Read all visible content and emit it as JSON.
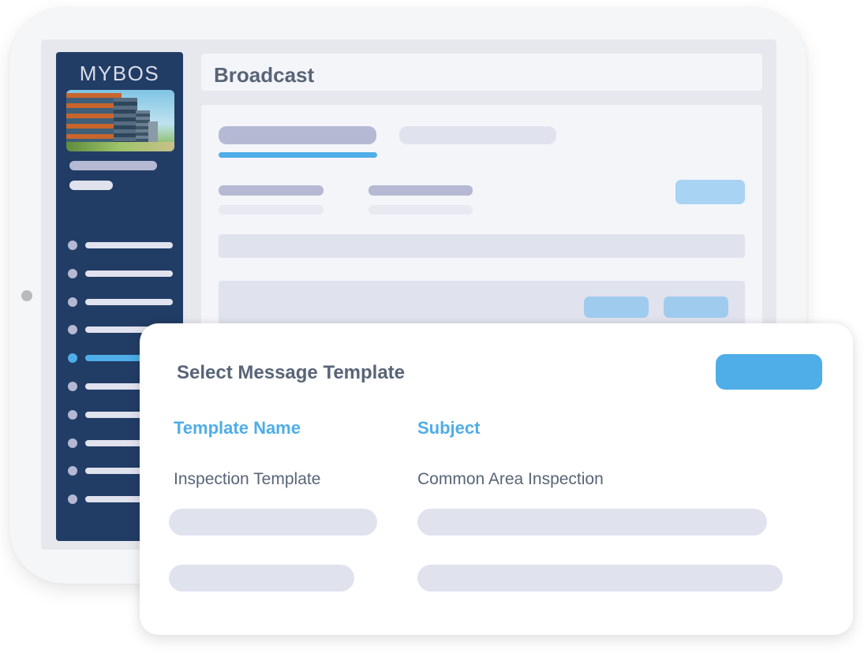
{
  "app": {
    "logo_text": "MYBOS",
    "page_title": "Broadcast"
  },
  "sidebar": {
    "building_image": "building-photo",
    "active_index": 4,
    "nav_item_count": 10
  },
  "modal": {
    "title": "Select Message Template",
    "columns": [
      {
        "label": "Template Name"
      },
      {
        "label": "Subject"
      }
    ],
    "rows": [
      {
        "template_name": "Inspection Template",
        "subject": "Common Area Inspection"
      }
    ]
  },
  "colors": {
    "sidebar_bg": "#223d65",
    "accent_blue": "#4fade8",
    "light_blue": "#a8d3f3",
    "text_gray": "#586577",
    "skeleton": "#e0e2ee",
    "skeleton_dark": "#b5b9d4"
  }
}
